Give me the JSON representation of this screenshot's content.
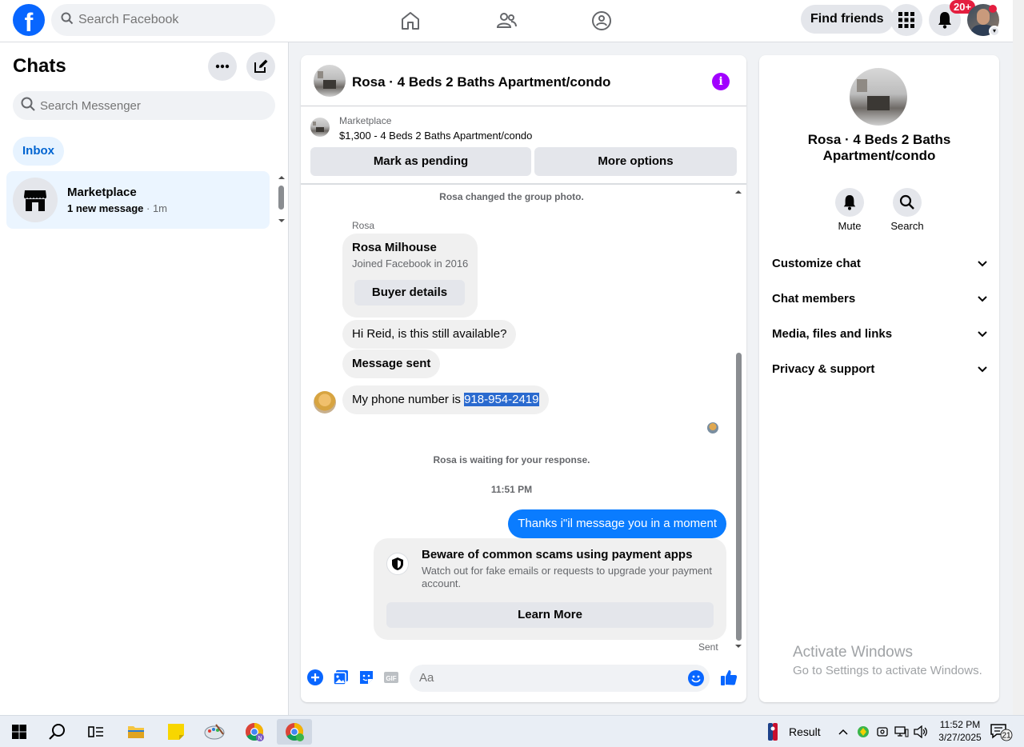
{
  "topbar": {
    "logo": "f",
    "search_placeholder": "Search Facebook",
    "find_friends": "Find friends",
    "notifications_badge": "20+"
  },
  "sidebar": {
    "title": "Chats",
    "search_placeholder": "Search Messenger",
    "filter": "Inbox",
    "chats": [
      {
        "name": "Marketplace",
        "unread": "1 new message",
        "time": " · 1m"
      }
    ]
  },
  "conversation": {
    "title": "Rosa · 4 Beds 2 Baths Apartment/condo",
    "listing": {
      "label": "Marketplace",
      "price_title": "$1,300 - 4 Beds 2 Baths Apartment/condo",
      "mark_pending": "Mark as pending",
      "more_options": "More options"
    },
    "system_changed_photo": "Rosa changed the group photo.",
    "sender": "Rosa",
    "buyer_card": {
      "name": "Rosa Milhouse",
      "joined": "Joined Facebook in 2016",
      "button": "Buyer details"
    },
    "messages_in": [
      "Hi Reid, is this still available?",
      "Message sent"
    ],
    "phone_message_prefix": "My phone number is ",
    "phone_number": "918-954-2419",
    "waiting": "Rosa is waiting for your response.",
    "timestamp": "11:51 PM",
    "message_out": "Thanks i\"il message you in a moment",
    "scam_warning": {
      "title": "Beware of common scams using payment apps",
      "body": "Watch out for fake emails or requests to upgrade your payment account.",
      "button": "Learn More"
    },
    "status": "Sent",
    "composer_placeholder": "Aa",
    "gif_label": "GIF"
  },
  "details": {
    "title": "Rosa · 4 Beds 2 Baths Apartment/condo",
    "mute": "Mute",
    "search": "Search",
    "sections": [
      "Customize chat",
      "Chat members",
      "Media, files and links",
      "Privacy & support"
    ]
  },
  "watermark": {
    "line1": "Activate Windows",
    "line2": "Go to Settings to activate Windows."
  },
  "taskbar": {
    "result": "Result",
    "time": "11:52 PM",
    "date": "3/27/2025",
    "notifications": "21"
  },
  "colors": {
    "facebook_blue": "#0866ff",
    "outgoing_bubble": "#0a7cff",
    "info_purple": "#a100ff",
    "badge_red": "#e41e3f"
  }
}
